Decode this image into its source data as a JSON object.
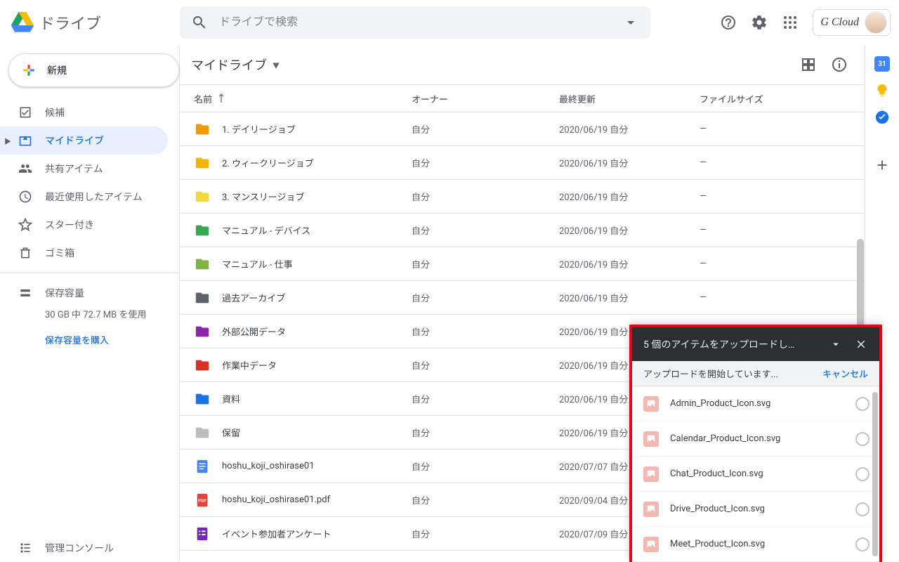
{
  "header": {
    "app_name": "ドライブ",
    "search_placeholder": "ドライブで検索",
    "account_name": "G Cloud"
  },
  "sidebar": {
    "new_label": "新規",
    "items": [
      {
        "label": "候補"
      },
      {
        "label": "マイドライブ"
      },
      {
        "label": "共有アイテム"
      },
      {
        "label": "最近使用したアイテム"
      },
      {
        "label": "スター付き"
      },
      {
        "label": "ゴミ箱"
      }
    ],
    "storage_label": "保存容量",
    "storage_usage": "30 GB 中 72.7 MB を使用",
    "storage_buy": "保存容量を購入",
    "admin_label": "管理コンソール"
  },
  "main": {
    "path": "マイドライブ",
    "cols": {
      "name": "名前",
      "owner": "オーナー",
      "modified": "最終更新",
      "size": "ファイルサイズ"
    },
    "owner_self": "自分",
    "size_dash": "—",
    "files": [
      {
        "type": "folder",
        "color": "#f29900",
        "name": "1. デイリージョブ",
        "owner": "自分",
        "modified": "2020/06/19 自分",
        "size": "—"
      },
      {
        "type": "folder",
        "color": "#f2b600",
        "name": "2. ウィークリージョブ",
        "owner": "自分",
        "modified": "2020/06/19 自分",
        "size": "—"
      },
      {
        "type": "folder",
        "color": "#f4d93e",
        "name": "3. マンスリージョブ",
        "owner": "自分",
        "modified": "2020/06/19 自分",
        "size": "—"
      },
      {
        "type": "folder",
        "color": "#34a853",
        "name": "マニュアル - デバイス",
        "owner": "自分",
        "modified": "2020/06/19 自分",
        "size": "—"
      },
      {
        "type": "folder",
        "color": "#7cb342",
        "name": "マニュアル - 仕事",
        "owner": "自分",
        "modified": "2020/06/19 自分",
        "size": "—"
      },
      {
        "type": "folder",
        "color": "#5f6368",
        "name": "過去アーカイブ",
        "owner": "自分",
        "modified": "2020/06/19 自分",
        "size": "—"
      },
      {
        "type": "folder",
        "color": "#8e24aa",
        "name": "外部公開データ",
        "owner": "自分",
        "modified": "2020/06/19 自分",
        "size": "—"
      },
      {
        "type": "folder",
        "color": "#d93025",
        "name": "作業中データ",
        "owner": "自分",
        "modified": "2020/06/19 自分",
        "size": "—"
      },
      {
        "type": "folder",
        "color": "#1a73e8",
        "name": "資料",
        "owner": "自分",
        "modified": "2020/06/19 自分",
        "size": "—"
      },
      {
        "type": "folder",
        "color": "#bdbdbd",
        "name": "保留",
        "owner": "自分",
        "modified": "2020/06/19 自分",
        "size": "—"
      },
      {
        "type": "doc",
        "color": "#4285f4",
        "name": "hoshu_koji_oshirase01",
        "owner": "自分",
        "modified": "2020/07/07 自分",
        "size": "—"
      },
      {
        "type": "pdf",
        "color": "#ea4335",
        "name": "hoshu_koji_oshirase01.pdf",
        "owner": "自分",
        "modified": "2020/09/04 自分",
        "size": "—"
      },
      {
        "type": "form",
        "color": "#7627bb",
        "name": "イベント参加者アンケート",
        "owner": "自分",
        "modified": "2020/07/09 自分",
        "size": "—"
      }
    ]
  },
  "upload": {
    "title": "5 個のアイテムをアップロードし…",
    "status": "アップロードを開始しています...",
    "cancel": "キャンセル",
    "items": [
      {
        "name": "Admin_Product_Icon.svg"
      },
      {
        "name": "Calendar_Product_Icon.svg"
      },
      {
        "name": "Chat_Product_Icon.svg"
      },
      {
        "name": "Drive_Product_Icon.svg"
      },
      {
        "name": "Meet_Product_Icon.svg"
      }
    ]
  }
}
